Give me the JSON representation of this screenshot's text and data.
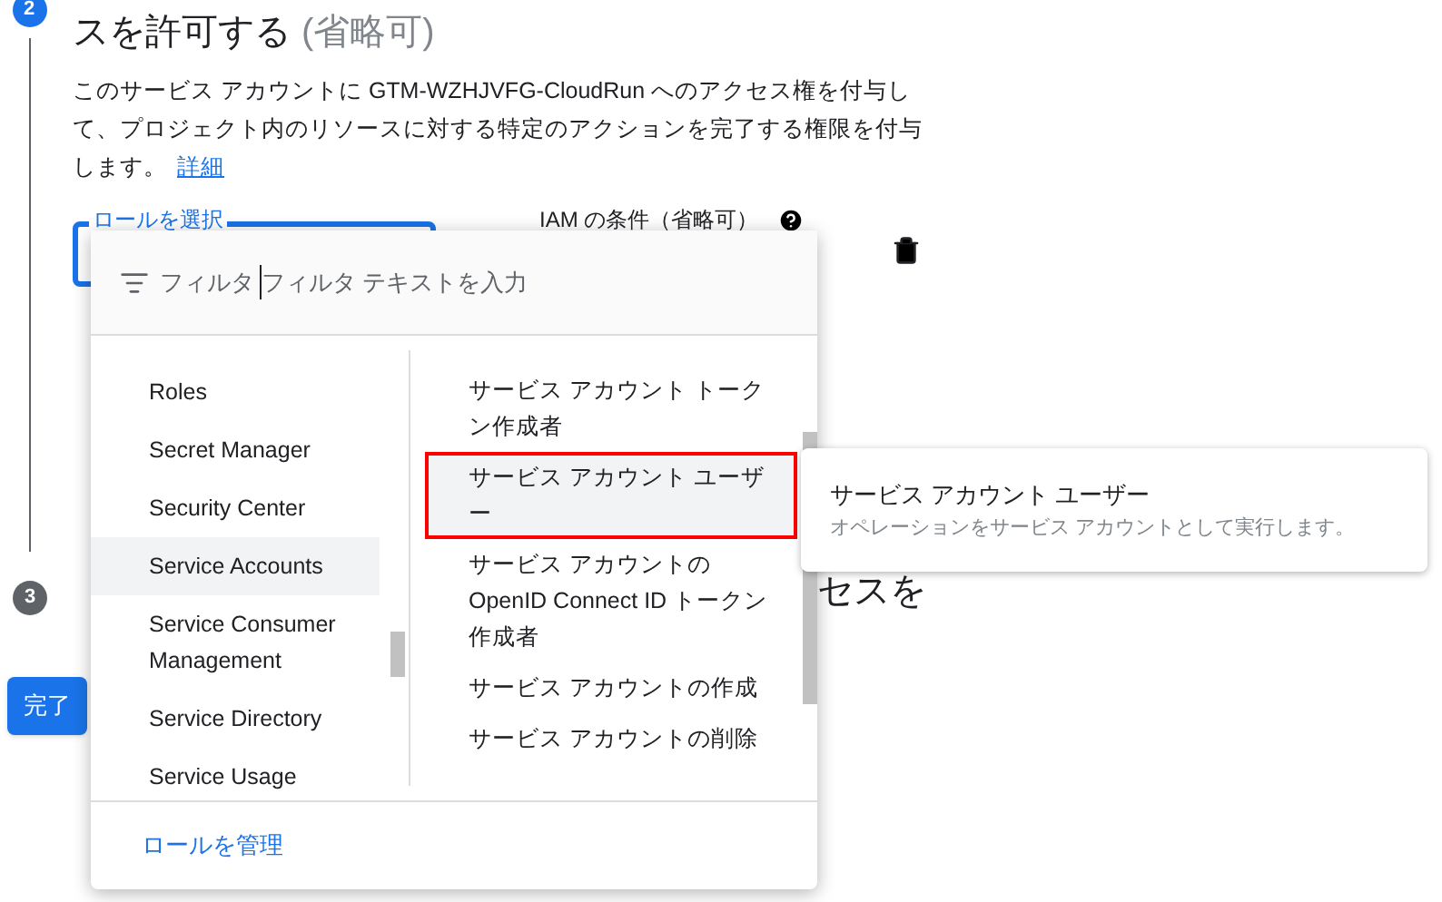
{
  "step2": {
    "number": "2",
    "title": "スを許可する",
    "title_note": "(省略可)",
    "description": "このサービス アカウントに GTM-WZHJVFG-CloudRun へのアクセス権を付与して、プロジェクト内のリソースに対する特定のアクションを完了する権限を付与します。",
    "link": "詳細",
    "role_field": {
      "label": "ロールを選択"
    },
    "condition_label": "IAM の条件（省略可）"
  },
  "step3": {
    "number": "3",
    "title_fragment": "セスを"
  },
  "done_button": "完了",
  "dropdown": {
    "filter_label": "フィルタ",
    "filter_placeholder": "フィルタ テキストを入力",
    "categories": [
      {
        "label": "Roles",
        "selected": false
      },
      {
        "label": "Secret Manager",
        "selected": false
      },
      {
        "label": "Security Center",
        "selected": false
      },
      {
        "label": "Service Accounts",
        "selected": true
      },
      {
        "label": "Service Consumer Management",
        "selected": false
      },
      {
        "label": "Service Directory",
        "selected": false
      },
      {
        "label": "Service Usage",
        "selected": false
      }
    ],
    "roles": [
      {
        "label": "サービス アカウント トークン作成者",
        "selected": false
      },
      {
        "label": "サービス アカウント ユーザー",
        "selected": true
      },
      {
        "label": "サービス アカウントの OpenID Connect ID トークン作成者",
        "selected": false
      },
      {
        "label": "サービス アカウントの作成",
        "selected": false
      },
      {
        "label": "サービス アカウントの削除",
        "selected": false
      }
    ],
    "manage_link": "ロールを管理"
  },
  "tooltip": {
    "title": "サービス アカウント ユーザー",
    "description": "オペレーションをサービス アカウントとして実行します。"
  }
}
